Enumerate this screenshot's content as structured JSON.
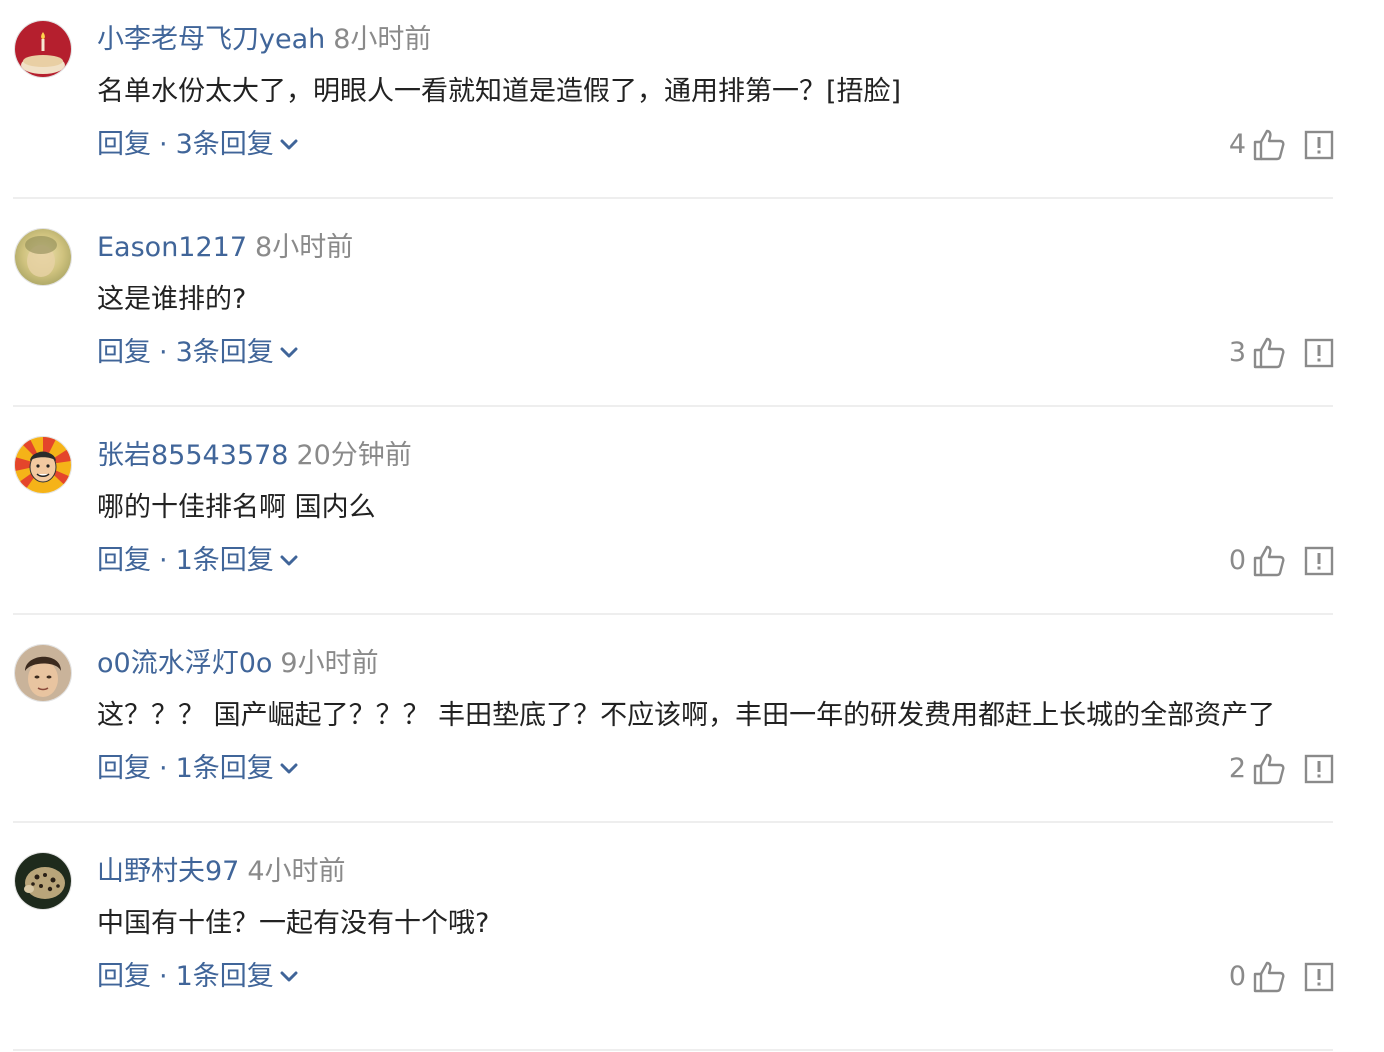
{
  "comments": [
    {
      "username": "小李老母飞刀yeah",
      "time": "8小时前",
      "text": "名单水份太大了，明眼人一看就知道是造假了，通用排第一？[捂脸]",
      "reply_label": "回复",
      "separator": "·",
      "reply_count_label": "3条回复",
      "likes": "4",
      "avatar": "cake-avatar"
    },
    {
      "username": "Eason1217",
      "time": "8小时前",
      "text": "这是谁排的?",
      "reply_label": "回复",
      "separator": "·",
      "reply_count_label": "3条回复",
      "likes": "3",
      "avatar": "blurred-face-avatar"
    },
    {
      "username": "张岩85543578",
      "time": "20分钟前",
      "text": "哪的十佳排名啊 国内么",
      "reply_label": "回复",
      "separator": "·",
      "reply_count_label": "1条回复",
      "likes": "0",
      "avatar": "cartoon-man-avatar"
    },
    {
      "username": "o0流水浮灯0o",
      "time": "9小时前",
      "text": "这？？？ 国产崛起了？？？ 丰田垫底了？不应该啊，丰田一年的研发费用都赶上长城的全部资产了",
      "reply_label": "回复",
      "separator": "·",
      "reply_count_label": "1条回复",
      "likes": "2",
      "avatar": "man-portrait-avatar"
    },
    {
      "username": "山野村夫97",
      "time": "4小时前",
      "text": "中国有十佳？一起有没有十个哦?",
      "reply_label": "回复",
      "separator": "·",
      "reply_count_label": "1条回复",
      "likes": "0",
      "avatar": "leopard-avatar"
    }
  ],
  "colors": {
    "username": "#406599",
    "meta": "#8a8a8a",
    "text": "#222222",
    "divider": "#eeeeee"
  }
}
